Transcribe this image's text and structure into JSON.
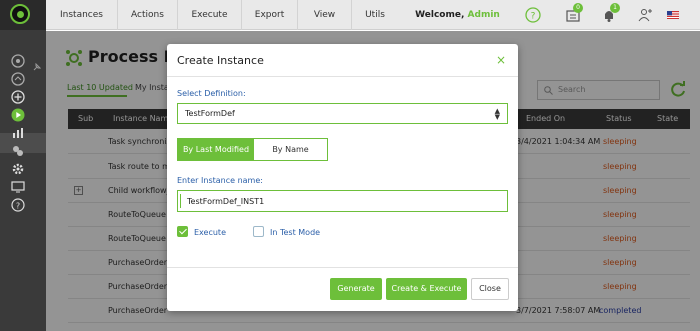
{
  "topnav": {
    "items": [
      "Instances",
      "Actions",
      "Execute",
      "Export",
      "View",
      "Utils"
    ],
    "welcome_prefix": "Welcome,",
    "welcome_user": "Admin",
    "tasks_badge": "0",
    "notifications_badge": "1"
  },
  "page": {
    "title": "Process Ins",
    "tabs": [
      "Last 10 Updated",
      "My Insta"
    ],
    "search_placeholder": "Search",
    "columns": [
      "Sub",
      "Instance Nam",
      "Ended On",
      "Status",
      "State"
    ],
    "rows": [
      {
        "name": "Task synchroniz",
        "ended": "3/4/2021 1:04:34 AM",
        "status": "sleeping",
        "expand": false
      },
      {
        "name": "Task route to m",
        "ended": "",
        "status": "sleeping",
        "expand": false
      },
      {
        "name": "Child workflow_",
        "ended": "",
        "status": "sleeping",
        "expand": true
      },
      {
        "name": "RouteToQueue",
        "ended": "",
        "status": "sleeping",
        "expand": false
      },
      {
        "name": "RouteToQueue",
        "ended": "",
        "status": "sleeping",
        "expand": false
      },
      {
        "name": "PurchaseOrder",
        "ended": "",
        "status": "sleeping",
        "expand": false
      },
      {
        "name": "PurchaseOrder",
        "ended": "",
        "status": "sleeping",
        "expand": false
      },
      {
        "name": "PurchaseOrder",
        "ended": "3/7/2021 7:58:07 AM",
        "status": "completed",
        "expand": false
      }
    ]
  },
  "modal": {
    "title": "Create Instance",
    "close_icon": "×",
    "select_label": "Select Definition:",
    "select_value": "TestFormDef",
    "seg_modified": "By Last Modified",
    "seg_name": "By Name",
    "name_label": "Enter Instance name:",
    "name_value": "TestFormDef_INST1",
    "execute_label": "Execute",
    "testmode_label": "In Test Mode",
    "execute_checked": true,
    "testmode_checked": false,
    "btn_generate": "Generate",
    "btn_genexec": "Create & Execute",
    "btn_close": "Close"
  },
  "colors": {
    "accent": "#6dbf3a",
    "sleeping": "#e05a1c",
    "completed": "#2a3fa8",
    "sidebar": "#3a3a3a"
  },
  "icons": [
    "logo-icon",
    "help-icon",
    "tasks-icon",
    "bell-icon",
    "user-add-icon",
    "us-flag-icon",
    "pin-icon",
    "dashboard-icon",
    "add-icon",
    "play-icon",
    "reports-icon",
    "gear-icon",
    "settings-icon",
    "monitor-icon",
    "help-icon",
    "search-icon",
    "refresh-icon",
    "process-icon",
    "caret-updown-icon"
  ]
}
